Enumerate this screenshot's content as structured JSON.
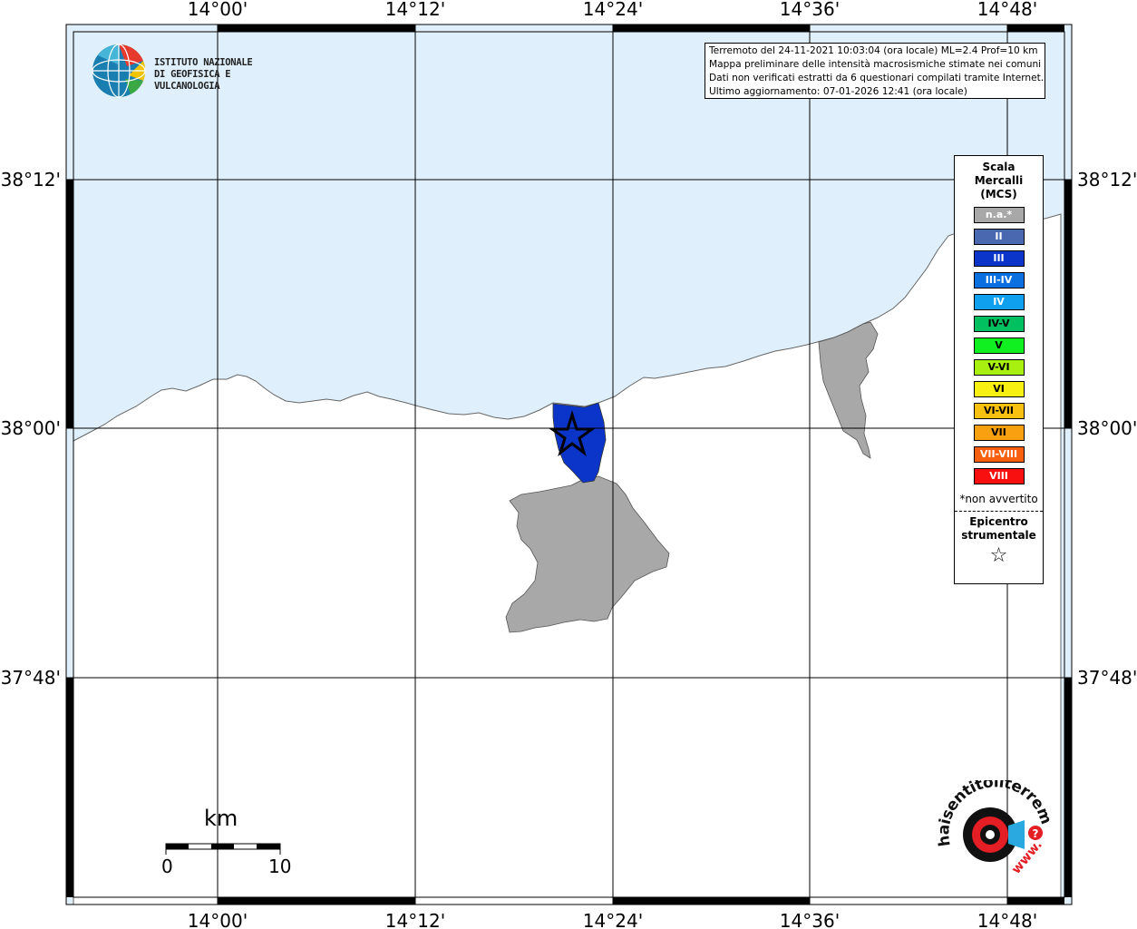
{
  "map": {
    "lon_labels": [
      "14°00'",
      "14°12'",
      "14°24'",
      "14°36'",
      "14°48'"
    ],
    "lat_labels": [
      "38°12'",
      "38°00'",
      "37°48'"
    ],
    "colors": {
      "sea": "#dff0fc",
      "land": "#ffffff",
      "coast": "#666666",
      "grid": "#000000",
      "no_data_area": "#a8a8a8",
      "intensity_III_area": "#0a35c8"
    }
  },
  "ingv_logo": {
    "line1": "ISTITUTO NAZIONALE",
    "line2": "DI GEOFISICA E VULCANOLOGIA"
  },
  "info_box": {
    "line1": "Terremoto del 24-11-2021 10:03:04 (ora locale) ML=2.4 Prof=10 km",
    "line2": "Mappa preliminare delle intensità macrosismiche stimate nei comuni",
    "line3": "Dati non verificati estratti da 6 questionari compilati tramite Internet.",
    "line4": "Ultimo aggiornamento: 07-01-2026 12:41 (ora locale)"
  },
  "legend": {
    "title_line1": "Scala",
    "title_line2": "Mercalli",
    "title_line3": "(MCS)",
    "classes": [
      {
        "label": "n.a.*",
        "color": "#a8a8a8"
      },
      {
        "label": "II",
        "color": "#4a68b0"
      },
      {
        "label": "III",
        "color": "#0a35c8"
      },
      {
        "label": "III-IV",
        "color": "#0a70e0"
      },
      {
        "label": "IV",
        "color": "#10a0f0"
      },
      {
        "label": "IV-V",
        "color": "#00c060"
      },
      {
        "label": "V",
        "color": "#10f020"
      },
      {
        "label": "V-VI",
        "color": "#a8f010"
      },
      {
        "label": "VI",
        "color": "#f8f010"
      },
      {
        "label": "VI-VII",
        "color": "#f8c010"
      },
      {
        "label": "VII",
        "color": "#f8a010"
      },
      {
        "label": "VII-VIII",
        "color": "#f86010"
      },
      {
        "label": "VIII",
        "color": "#f81010"
      }
    ],
    "note": "*non avvertito",
    "epicenter_line1": "Epicentro",
    "epicenter_line2": "strumentale",
    "epicenter_symbol": "☆"
  },
  "scale_bar": {
    "unit": "km",
    "min_label": "0",
    "max_label": "10"
  },
  "hst_logo": {
    "text": "haisentitoilterremoto.it",
    "prefix": "www.",
    "accent": "#e31e24"
  }
}
